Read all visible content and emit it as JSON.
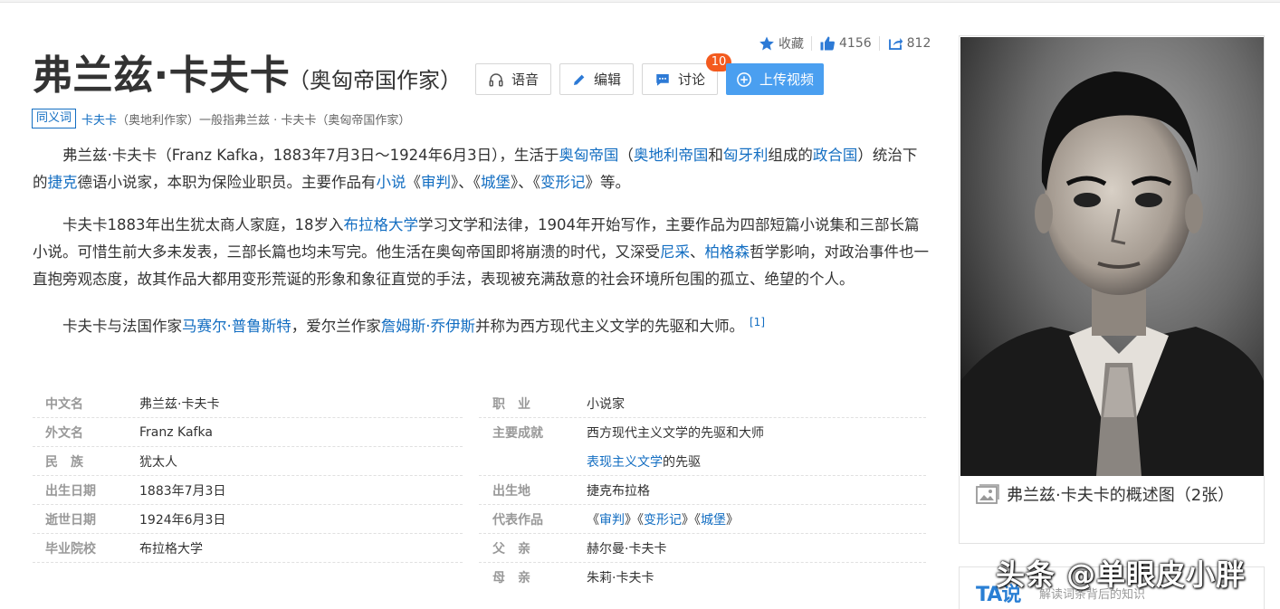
{
  "stats": {
    "favorite_label": "收藏",
    "likes": "4156",
    "shares": "812"
  },
  "title": {
    "name": "弗兰兹·卡夫卡",
    "subtitle": "（奥匈帝国作家）"
  },
  "toolbar": {
    "voice": "语音",
    "edit": "编辑",
    "discuss": "讨论",
    "discuss_badge": "10",
    "upload": "上传视频"
  },
  "synonym": {
    "tag": "同义词",
    "link": "卡夫卡",
    "text": "（奥地利作家）一般指弗兰兹 · 卡夫卡（奥匈帝国作家）"
  },
  "paragraphs": {
    "p1": [
      {
        "t": "弗兰兹·卡夫卡（Franz Kafka，1883年7月3日～1924年6月3日），生活于"
      },
      {
        "t": "奥匈帝国",
        "link": true
      },
      {
        "t": "（"
      },
      {
        "t": "奥地利帝国",
        "link": true
      },
      {
        "t": "和"
      },
      {
        "t": "匈牙利",
        "link": true
      },
      {
        "t": "组成的"
      },
      {
        "t": "政合国",
        "link": true
      },
      {
        "t": "）统治下的"
      },
      {
        "t": "捷克",
        "link": true
      },
      {
        "t": "德语小说家，本职为保险业职员。主要作品有"
      },
      {
        "t": "小说",
        "link": true
      },
      {
        "t": "《"
      },
      {
        "t": "审判",
        "link": true
      },
      {
        "t": "》、《"
      },
      {
        "t": "城堡",
        "link": true
      },
      {
        "t": "》、《"
      },
      {
        "t": "变形记",
        "link": true
      },
      {
        "t": "》等。"
      }
    ],
    "p2": [
      {
        "t": "卡夫卡1883年出生犹太商人家庭，18岁入"
      },
      {
        "t": "布拉格大学",
        "link": true
      },
      {
        "t": "学习文学和法律，1904年开始写作，主要作品为四部短篇小说集和三部长篇小说。可惜生前大多未发表，三部长篇也均未写完。他生活在奥匈帝国即将崩溃的时代，又深受"
      },
      {
        "t": "尼采",
        "link": true
      },
      {
        "t": "、"
      },
      {
        "t": "柏格森",
        "link": true
      },
      {
        "t": "哲学影响，对政治事件也一直抱旁观态度，故其作品大都用变形荒诞的形象和象征直觉的手法，表现被充满敌意的社会环境所包围的孤立、绝望的个人。"
      }
    ],
    "p3": [
      {
        "t": "卡夫卡与法国作家"
      },
      {
        "t": "马赛尔·普鲁斯特",
        "link": true
      },
      {
        "t": "，爱尔兰作家"
      },
      {
        "t": "詹姆斯·乔伊斯",
        "link": true
      },
      {
        "t": "并称为西方现代主义文学的先驱和大师。"
      }
    ],
    "p3_ref": "[1]"
  },
  "info_left": [
    {
      "k": "中文名",
      "v": "弗兰兹·卡夫卡"
    },
    {
      "k": "外文名",
      "v": "Franz Kafka"
    },
    {
      "k": "民　族",
      "v": "犹太人"
    },
    {
      "k": "出生日期",
      "v": "1883年7月3日"
    },
    {
      "k": "逝世日期",
      "v": "1924年6月3日"
    },
    {
      "k": "毕业院校",
      "v": "布拉格大学"
    }
  ],
  "info_right": {
    "occupation_k": "职　业",
    "occupation_v": "小说家",
    "achieve_k": "主要成就",
    "achieve_v1": "西方现代主义文学的先驱和大师",
    "achieve_v2_link": "表现主义文学",
    "achieve_v2_rest": "的先驱",
    "birthplace_k": "出生地",
    "birthplace_v": "捷克布拉格",
    "works_k": "代表作品",
    "works": [
      "审判",
      "变形记",
      "城堡"
    ],
    "father_k": "父　亲",
    "father_v": "赫尔曼·卡夫卡",
    "mother_k": "母　亲",
    "mother_v": "朱莉·卡夫卡"
  },
  "image_card": {
    "caption": "弗兰兹·卡夫卡的概述图（2张）"
  },
  "tag_card": {
    "logo": "TA说",
    "sub": "解读词条背后的知识"
  },
  "watermark": "头条 @单眼皮小胖",
  "colors": {
    "link": "#136ec2",
    "primary_button": "#4a9ff0",
    "badge": "#f35a1e"
  }
}
